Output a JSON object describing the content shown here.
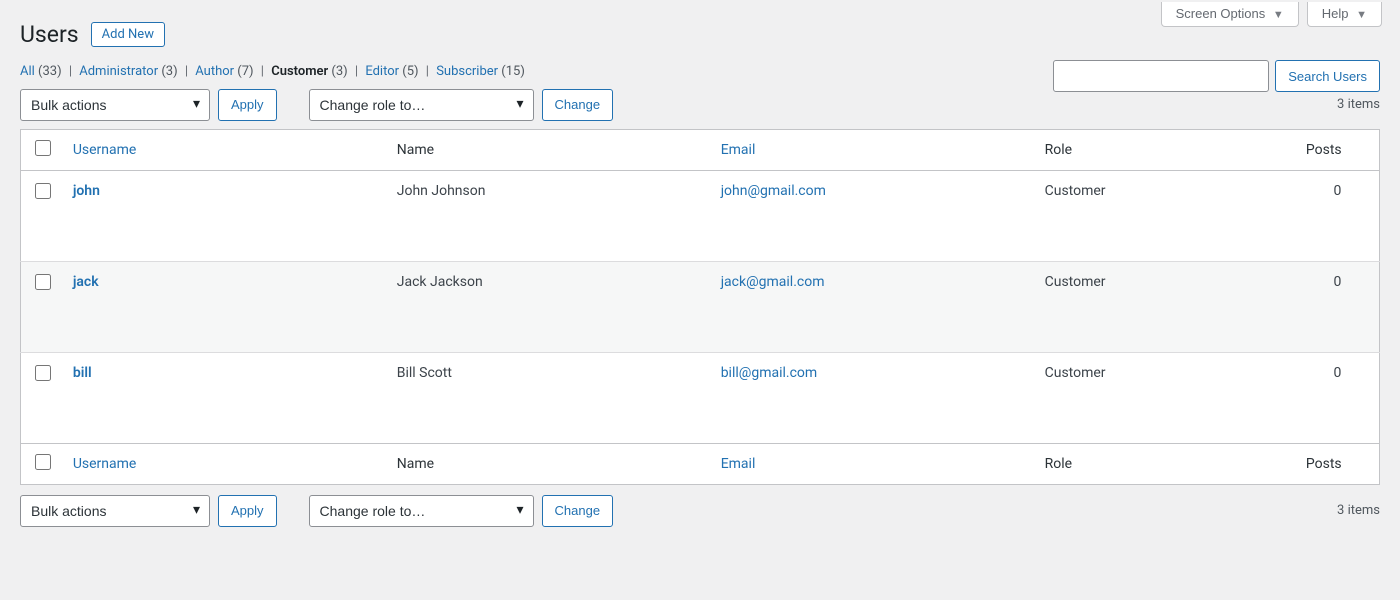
{
  "screen_meta": {
    "screen_options": "Screen Options",
    "help": "Help"
  },
  "header": {
    "title": "Users",
    "add_new": "Add New"
  },
  "filters": [
    {
      "label": "All",
      "count": "(33)",
      "current": false
    },
    {
      "label": "Administrator",
      "count": "(3)",
      "current": false
    },
    {
      "label": "Author",
      "count": "(7)",
      "current": false
    },
    {
      "label": "Customer",
      "count": "(3)",
      "current": true
    },
    {
      "label": "Editor",
      "count": "(5)",
      "current": false
    },
    {
      "label": "Subscriber",
      "count": "(15)",
      "current": false
    }
  ],
  "bulk": {
    "bulk_actions": "Bulk actions",
    "apply": "Apply",
    "change_role": "Change role to…",
    "change": "Change"
  },
  "search": {
    "button": "Search Users",
    "value": ""
  },
  "pagination": {
    "items_text": "3 items"
  },
  "columns": {
    "username": "Username",
    "name": "Name",
    "email": "Email",
    "role": "Role",
    "posts": "Posts"
  },
  "rows": [
    {
      "username": "john",
      "name": "John Johnson",
      "email": "john@gmail.com",
      "role": "Customer",
      "posts": "0"
    },
    {
      "username": "jack",
      "name": "Jack Jackson",
      "email": "jack@gmail.com",
      "role": "Customer",
      "posts": "0"
    },
    {
      "username": "bill",
      "name": "Bill Scott",
      "email": "bill@gmail.com",
      "role": "Customer",
      "posts": "0"
    }
  ]
}
